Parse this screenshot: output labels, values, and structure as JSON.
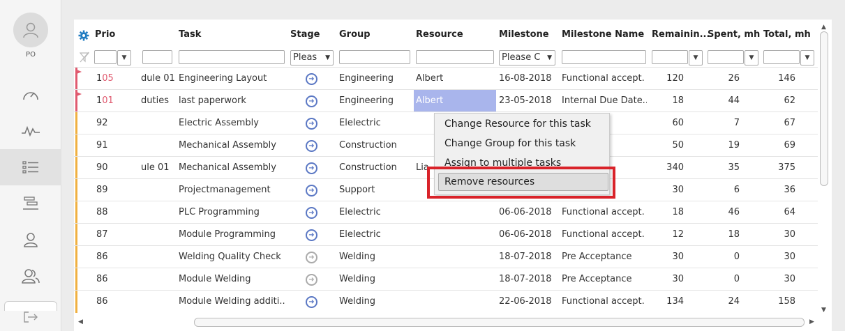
{
  "sidebar": {
    "user_label": "PO",
    "items": [
      {
        "icon": "speedometer-icon"
      },
      {
        "icon": "activity-icon"
      },
      {
        "icon": "list-icon"
      },
      {
        "icon": "gantt-icon"
      },
      {
        "icon": "user-icon"
      },
      {
        "icon": "users-icon"
      },
      {
        "icon": "logout-icon"
      }
    ]
  },
  "grid": {
    "headers": {
      "prio": "Prio",
      "task": "Task",
      "stage": "Stage",
      "group": "Group",
      "resource": "Resource",
      "milestone": "Milestone",
      "milestone_name": "Milestone Name",
      "remaining": "Remainin...",
      "spent": "Spent, mh",
      "total": "Total, mh"
    },
    "filters": {
      "stage_placeholder": "Pleas",
      "milestone_placeholder": "Please C"
    },
    "rows": [
      {
        "prio": "105",
        "prio_red": true,
        "module": "dule 01",
        "task": "Engineering Layout",
        "stage": "blue",
        "group": "Engineering",
        "resource": "Albert",
        "milestone": "16-08-2018",
        "milestone_name": "Functional accept.",
        "remaining": "120",
        "spent": "26",
        "total": "146",
        "flag": "#e05a6f"
      },
      {
        "prio": "101",
        "prio_red": true,
        "module": "duties",
        "task": "last paperwork",
        "stage": "blue",
        "group": "Engineering",
        "resource": "Albert",
        "milestone": "23-05-2018",
        "milestone_name": "Internal Due Date...",
        "remaining": "18",
        "spent": "44",
        "total": "62",
        "flag": "#e05a6f"
      },
      {
        "prio": "92",
        "module": "",
        "task": "Electric Assembly",
        "stage": "blue",
        "group": "Elelectric",
        "resource": "",
        "milestone": "",
        "milestone_name": "ccept.",
        "remaining": "60",
        "spent": "7",
        "total": "67",
        "flag": "#f0b040"
      },
      {
        "prio": "91",
        "module": "",
        "task": "Mechanical Assembly",
        "stage": "blue",
        "group": "Construction",
        "resource": "",
        "milestone": "",
        "milestone_name": "ccept.",
        "remaining": "50",
        "spent": "19",
        "total": "69",
        "flag": "#f0b040"
      },
      {
        "prio": "90",
        "module": "ule 01",
        "task": "Mechanical Assembly",
        "stage": "blue",
        "group": "Construction",
        "resource": "Lia",
        "milestone": "",
        "milestone_name": "ccept.",
        "remaining": "340",
        "spent": "35",
        "total": "375",
        "flag": "#f0b040"
      },
      {
        "prio": "89",
        "module": "",
        "task": "Projectmanagement",
        "stage": "blue",
        "group": "Support",
        "resource": "",
        "milestone": "",
        "milestone_name": "ccept.",
        "remaining": "30",
        "spent": "6",
        "total": "36",
        "flag": "#f0b040"
      },
      {
        "prio": "88",
        "module": "",
        "task": "PLC Programming",
        "stage": "blue",
        "group": "Elelectric",
        "resource": "",
        "milestone": "06-06-2018",
        "milestone_name": "Functional accept.",
        "remaining": "18",
        "spent": "46",
        "total": "64",
        "flag": "#f0b040"
      },
      {
        "prio": "87",
        "module": "",
        "task": "Module Programming",
        "stage": "blue",
        "group": "Elelectric",
        "resource": "",
        "milestone": "06-06-2018",
        "milestone_name": "Functional accept.",
        "remaining": "12",
        "spent": "18",
        "total": "30",
        "flag": "#f0b040"
      },
      {
        "prio": "86",
        "module": "",
        "task": "Welding Quality Check",
        "stage": "grey",
        "group": "Welding",
        "resource": "",
        "milestone": "18-07-2018",
        "milestone_name": "Pre Acceptance",
        "remaining": "30",
        "spent": "0",
        "total": "30",
        "flag": "#f0b040"
      },
      {
        "prio": "86",
        "module": "",
        "task": "Module Welding",
        "stage": "grey",
        "group": "Welding",
        "resource": "",
        "milestone": "18-07-2018",
        "milestone_name": "Pre Acceptance",
        "remaining": "30",
        "spent": "0",
        "total": "30",
        "flag": "#f0b040"
      },
      {
        "prio": "86",
        "module": "",
        "task": "Module Welding additi...",
        "stage": "blue",
        "group": "Welding",
        "resource": "",
        "milestone": "22-06-2018",
        "milestone_name": "Functional accept.",
        "remaining": "134",
        "spent": "24",
        "total": "158",
        "flag": "#f0b040"
      }
    ]
  },
  "context_menu": {
    "items": [
      "Change Resource for this task",
      "Change Group for this task",
      "Assign to multiple tasks",
      "Remove resources"
    ]
  },
  "colors": {
    "accent_blue": "#5b78c4",
    "prio_red": "#e05a6f",
    "selected_cell": "#a9b5ec",
    "highlight_red": "#d9232a"
  }
}
